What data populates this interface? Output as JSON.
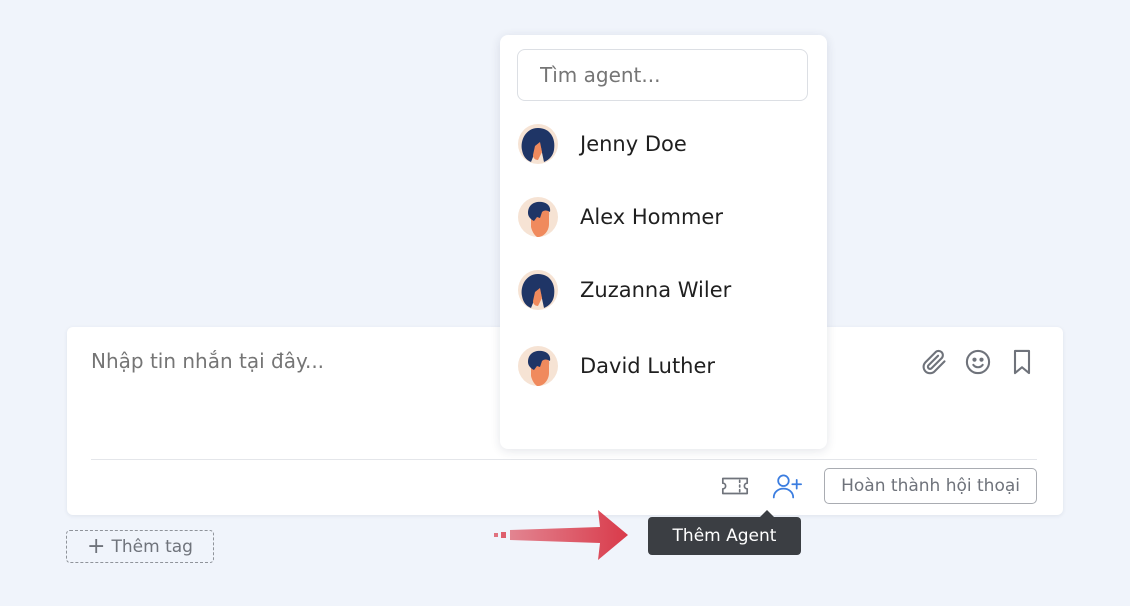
{
  "composer": {
    "placeholder": "Nhập tin nhắn tại đây...",
    "tools": [
      {
        "icon": "paperclip-icon"
      },
      {
        "icon": "smiley-icon"
      },
      {
        "icon": "bookmark-icon"
      }
    ],
    "footer": {
      "ticket_icon": "ticket-icon",
      "add_agent_icon": "user-plus-icon",
      "finish_label": "Hoàn thành hội thoại"
    }
  },
  "tag": {
    "label": "Thêm tag"
  },
  "dropdown": {
    "search_placeholder": "Tìm agent...",
    "agents": [
      {
        "name": "Jenny Doe",
        "avatar": "female"
      },
      {
        "name": "Alex Hommer",
        "avatar": "male"
      },
      {
        "name": "Zuzanna Wiler",
        "avatar": "female"
      },
      {
        "name": "David Luther",
        "avatar": "male"
      }
    ]
  },
  "tooltip": {
    "label": "Thêm Agent"
  },
  "colors": {
    "accent": "#3b7de0",
    "arrow": "#d93a4a",
    "tooltip_bg": "#3b3e43"
  }
}
